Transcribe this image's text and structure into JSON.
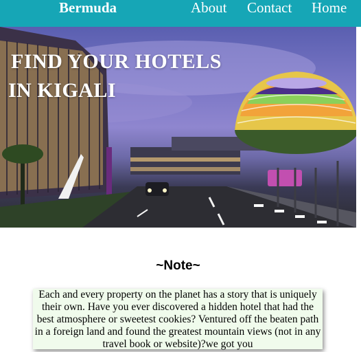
{
  "nav": {
    "brand": "Bermuda",
    "links": [
      {
        "label": "About"
      },
      {
        "label": "Contact"
      },
      {
        "label": "Home"
      }
    ]
  },
  "hero": {
    "title_line1": "FIND YOUR HOTELS",
    "title_line2": "IN KIGALI"
  },
  "note": {
    "heading": "~Note~",
    "text": "Each and every property on the planet has a story that is uniquely their own. Have you ever discovered a hidden hotel that had the best atmosphere or sweetest cookies? Ventured off the beaten path in a foreign land and found the greatest mountain views (not in any travel book or website)?we got you"
  },
  "colors": {
    "navbar": "#16a6b6",
    "note_background": "#f0fbec"
  }
}
